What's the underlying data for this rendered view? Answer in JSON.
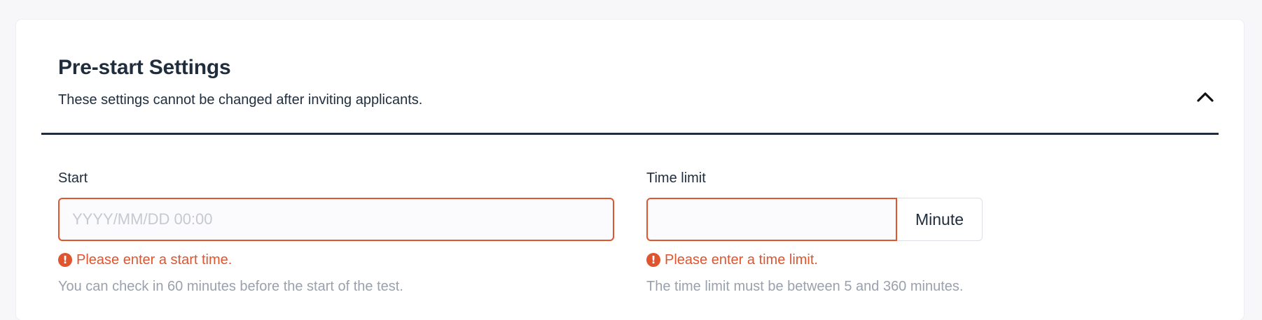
{
  "section": {
    "title": "Pre-start Settings",
    "subtitle": "These settings cannot be changed after inviting applicants.",
    "collapse_icon": "chevron-up-icon"
  },
  "start_field": {
    "label": "Start",
    "value": "",
    "placeholder": "YYYY/MM/DD 00:00",
    "error": "Please enter a start time.",
    "help": "You can check in 60 minutes before the start of the test."
  },
  "time_limit_field": {
    "label": "Time limit",
    "value": "",
    "unit": "Minute",
    "error": "Please enter a time limit.",
    "help": "The time limit must be between 5 and 360 minutes."
  },
  "colors": {
    "error": "#e0542e",
    "text": "#1f2d3d",
    "muted": "#9aa1ad",
    "divider": "#1f2d3d"
  },
  "icons": {
    "error": "exclamation-circle-icon"
  }
}
